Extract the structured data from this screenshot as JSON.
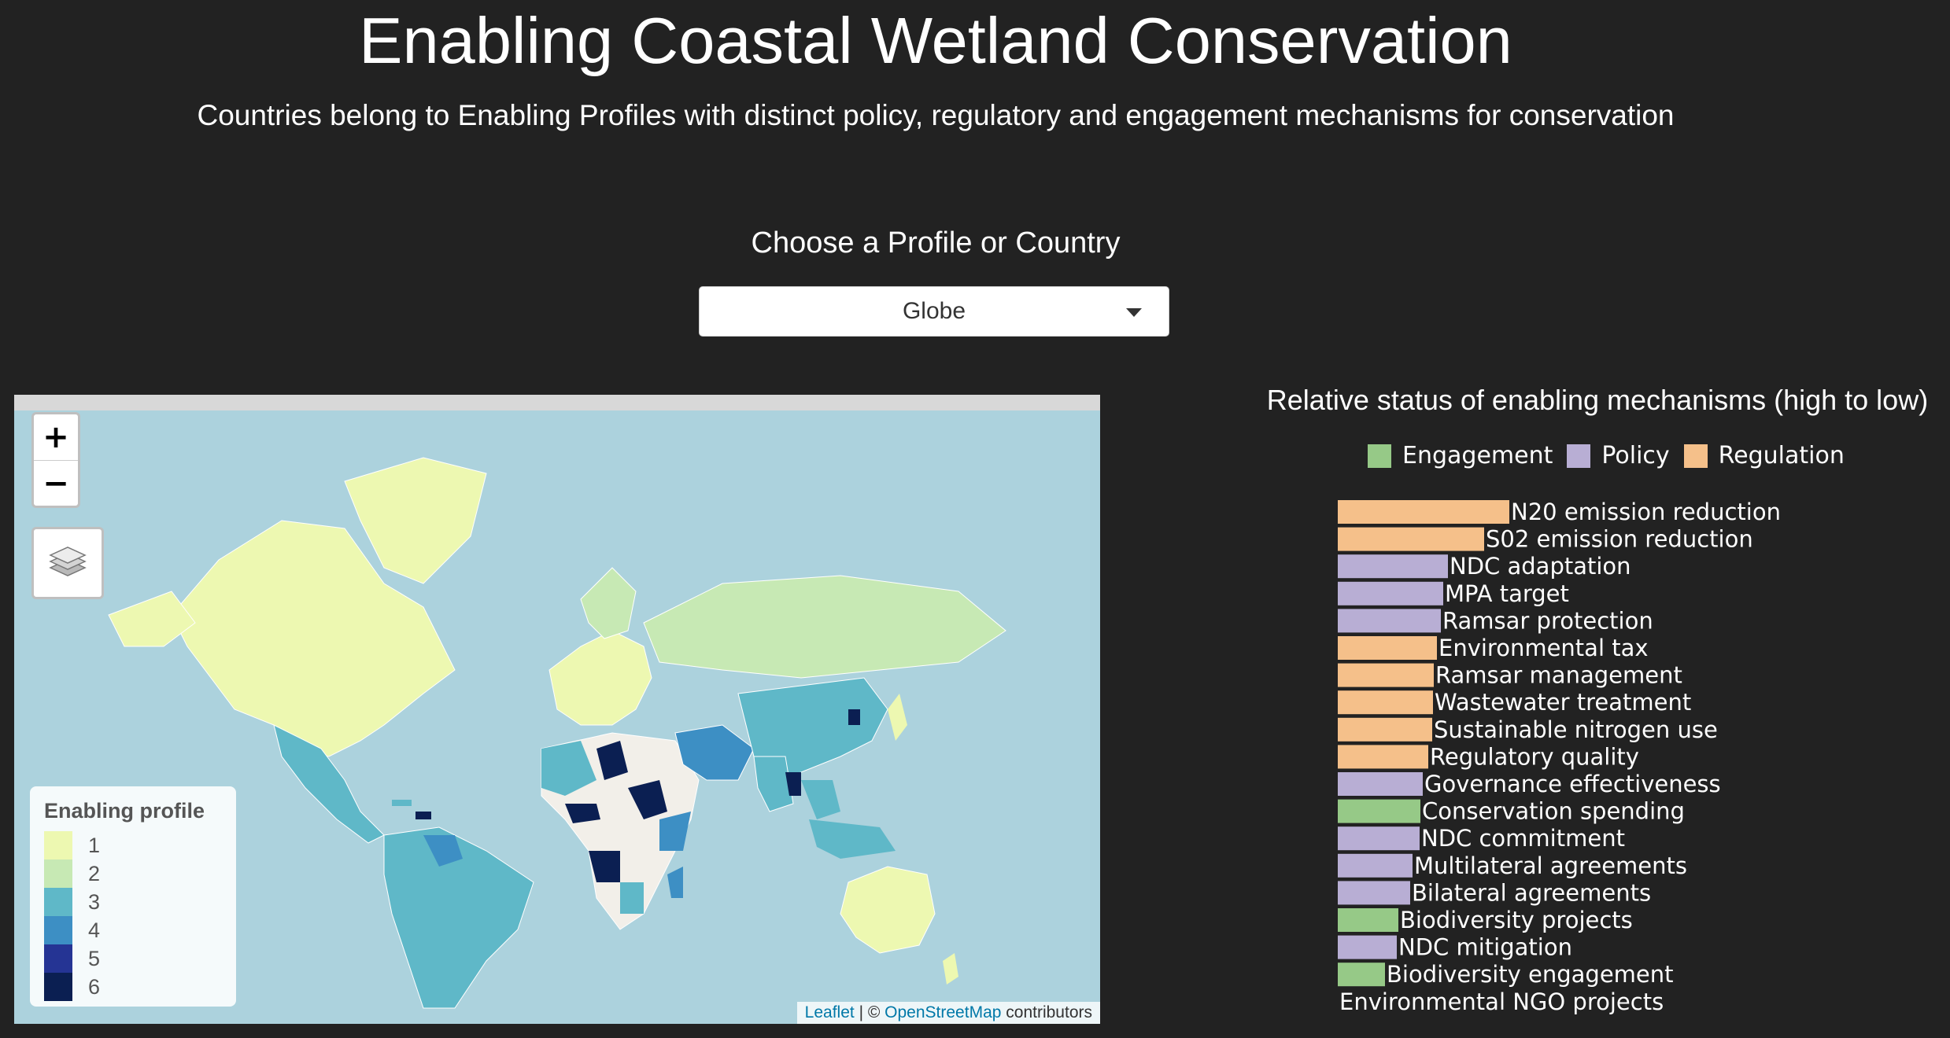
{
  "header": {
    "title": "Enabling Coastal Wetland Conservation",
    "subtitle": "Countries belong to Enabling Profiles with distinct policy, regulatory and engagement mechanisms for conservation"
  },
  "chooser": {
    "label": "Choose a Profile or Country",
    "selected": "Globe"
  },
  "map": {
    "zoom_in": "+",
    "zoom_out": "−",
    "layers_icon": "layers-icon",
    "legend": {
      "title": "Enabling profile",
      "items": [
        {
          "label": "1",
          "color": "#edf8b1"
        },
        {
          "label": "2",
          "color": "#c7e9b4"
        },
        {
          "label": "3",
          "color": "#5fb8c8"
        },
        {
          "label": "4",
          "color": "#3d8fc4"
        },
        {
          "label": "5",
          "color": "#253494"
        },
        {
          "label": "6",
          "color": "#0b1f52"
        }
      ]
    },
    "attribution": {
      "leaflet": "Leaflet",
      "sep": "| ©",
      "osm": "OpenStreetMap",
      "suffix": "contributors"
    },
    "ocean_color": "#acd2dd",
    "land_color": "#f2efe9"
  },
  "mechanisms": {
    "title": "Relative status of enabling mechanisms (high to low)",
    "legend": [
      {
        "label": "Engagement",
        "color": "#96c987"
      },
      {
        "label": "Policy",
        "color": "#b8aed4"
      },
      {
        "label": "Regulation",
        "color": "#f5c08a"
      }
    ]
  },
  "chart_data": {
    "type": "bar",
    "orientation": "horizontal",
    "title": "Relative status of enabling mechanisms (high to low)",
    "categories": [
      "N20 emission reduction",
      "S02 emission reduction",
      "NDC adaptation",
      "MPA target",
      "Ramsar protection",
      "Environmental tax",
      "Ramsar management",
      "Wastewater treatment",
      "Sustainable nitrogen use",
      "Regulatory quality",
      "Governance effectiveness",
      "Conservation spending",
      "NDC commitment",
      "Multilateral agreements",
      "Bilateral agreements",
      "Biodiversity projects",
      "NDC mitigation",
      "Biodiversity engagement",
      "Environmental NGO projects"
    ],
    "groups": [
      "Regulation",
      "Regulation",
      "Policy",
      "Policy",
      "Policy",
      "Regulation",
      "Regulation",
      "Regulation",
      "Regulation",
      "Regulation",
      "Policy",
      "Engagement",
      "Policy",
      "Policy",
      "Policy",
      "Engagement",
      "Policy",
      "Engagement",
      "Engagement"
    ],
    "values": [
      0.218,
      0.186,
      0.14,
      0.134,
      0.131,
      0.126,
      0.122,
      0.121,
      0.12,
      0.115,
      0.108,
      0.105,
      0.104,
      0.095,
      0.092,
      0.077,
      0.075,
      0.06,
      0.0
    ],
    "legend": [
      "Engagement",
      "Policy",
      "Regulation"
    ]
  }
}
